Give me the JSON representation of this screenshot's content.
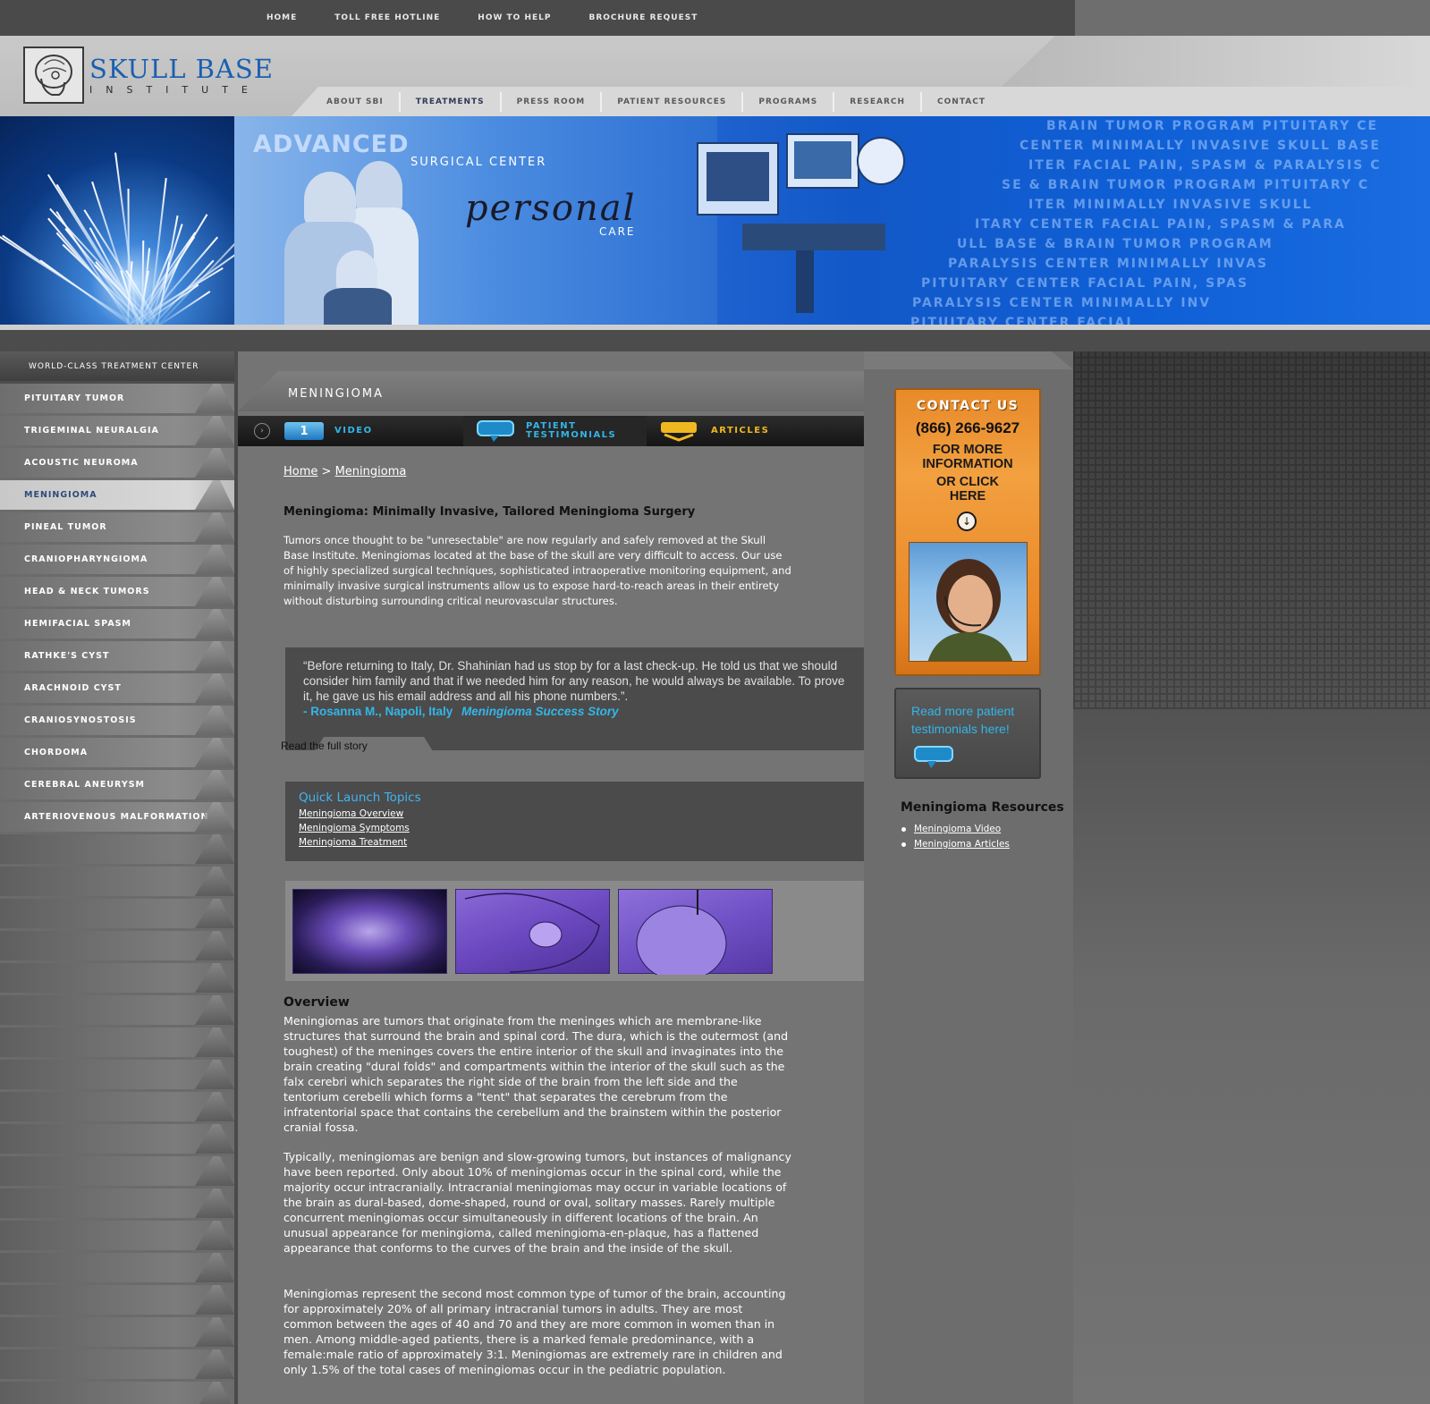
{
  "top_nav": [
    "HOME",
    "TOLL FREE HOTLINE",
    "HOW TO HELP",
    "BROCHURE REQUEST"
  ],
  "logo": {
    "title": "SKULL BASE",
    "subtitle": "INSTITUTE"
  },
  "main_nav": [
    {
      "label": "ABOUT SBI",
      "active": false
    },
    {
      "label": "TREATMENTS",
      "active": true
    },
    {
      "label": "PRESS ROOM",
      "active": false
    },
    {
      "label": "PATIENT RESOURCES",
      "active": false
    },
    {
      "label": "PROGRAMS",
      "active": false
    },
    {
      "label": "RESEARCH",
      "active": false
    },
    {
      "label": "CONTACT",
      "active": false
    }
  ],
  "banner": {
    "title": "ADVANCED",
    "subtitle": "SURGICAL CENTER",
    "script": "personal",
    "care": "CARE",
    "words": [
      "BRAIN TUMOR PROGRAM  PITUITARY CE",
      "CENTER  MINIMALLY INVASIVE SKULL BASE",
      "ITER  FACIAL PAIN, SPASM & PARALYSIS C",
      "SE & BRAIN TUMOR PROGRAM  PITUITARY C",
      "ITER  MINIMALLY INVASIVE SKULL",
      "ITARY CENTER  FACIAL PAIN, SPASM & PARA",
      "ULL BASE & BRAIN TUMOR PROGRAM",
      "PARALYSIS CENTER  MINIMALLY INVAS",
      "PITUITARY CENTER  FACIAL PAIN, SPAS",
      "PARALYSIS CENTER  MINIMALLY INV",
      "PITUITARY CENTER  FACIAL"
    ]
  },
  "sidebar": {
    "heading": "WORLD-CLASS TREATMENT CENTER",
    "items": [
      {
        "label": "PITUITARY TUMOR",
        "active": false
      },
      {
        "label": "TRIGEMINAL NEURALGIA",
        "active": false
      },
      {
        "label": "ACOUSTIC NEUROMA",
        "active": false
      },
      {
        "label": "MENINGIOMA",
        "active": true
      },
      {
        "label": "PINEAL TUMOR",
        "active": false
      },
      {
        "label": "CRANIOPHARYNGIOMA",
        "active": false
      },
      {
        "label": "HEAD & NECK TUMORS",
        "active": false
      },
      {
        "label": "HEMIFACIAL SPASM",
        "active": false
      },
      {
        "label": "RATHKE'S CYST",
        "active": false
      },
      {
        "label": "ARACHNOID CYST",
        "active": false
      },
      {
        "label": "CRANIOSYNOSTOSIS",
        "active": false
      },
      {
        "label": "CHORDOMA",
        "active": false
      },
      {
        "label": "CEREBRAL ANEURYSM",
        "active": false
      },
      {
        "label": "ARTERIOVENOUS MALFORMATION",
        "active": false
      }
    ]
  },
  "main": {
    "page_title": "MENINGIOMA",
    "media_tabs": {
      "video": "VIDEO",
      "testimonials_1": "PATIENT",
      "testimonials_2": "TESTIMONIALS",
      "articles": "ARTICLES"
    },
    "breadcrumb": {
      "home": "Home",
      "separator": ">",
      "current": "Meningioma"
    },
    "article_title": "Meningioma: Minimally Invasive, Tailored Meningioma Surgery",
    "intro": "Tumors once thought to be \"unresectable\" are now regularly and safely removed at the Skull Base Institute. Meningiomas located at the base of the skull are very difficult to access. Our use of highly specialized surgical techniques, sophisticated intraoperative monitoring equipment, and minimally invasive surgical instruments allow us to expose hard-to-reach areas in their entirety without disturbing surrounding critical neurovascular structures.",
    "quote": {
      "text": "“Before returning to Italy, Dr. Shahinian had us stop by for a last check-up. He told us that we should consider him family and that if we needed him for any reason, he would always be available. To prove it, he gave us his email address and all his phone numbers.”.",
      "author": "- Rosanna M., Napoli, Italy",
      "story_link": "Meningioma Success Story",
      "read_full": "Read the full story"
    },
    "quick_launch": {
      "title": "Quick Launch Topics",
      "links": [
        "Meningioma Overview",
        "Meningioma Symptoms",
        "Meningioma Treatment"
      ]
    },
    "overview_title": "Overview",
    "paragraphs": [
      "Meningiomas are tumors that originate from the meninges which are membrane-like structures that surround the brain and spinal cord. The dura, which is the outermost (and toughest) of the meninges covers the entire interior of the skull and invaginates into the brain creating \"dural folds\" and compartments within the interior of the skull such as the falx cerebri which separates the right side of the brain from the left side and the tentorium cerebelli which forms a \"tent\" that separates the cerebrum from the infratentorial space that contains the cerebellum and the brainstem within the posterior cranial fossa.",
      "Typically, meningiomas are benign and slow-growing tumors, but instances of malignancy have been reported. Only about 10% of meningiomas occur in the spinal cord, while the majority occur intracranially. Intracranial meningiomas may occur in variable locations of the brain as dural-based, dome-shaped, round or oval, solitary masses. Rarely multiple concurrent meningiomas occur simultaneously in different locations of the brain. An unusual appearance for meningioma, called meningioma-en-plaque, has a flattened appearance that conforms to the curves of the brain and the inside of the skull.",
      "Meningiomas represent the second most common type of tumor of the brain, accounting for approximately 20% of all primary intracranial tumors in adults. They are most common between the ages of 40 and 70 and they are more common in women than in men. Among middle-aged patients, there is a marked female predominance, with a female:male ratio of approximately 3:1. Meningiomas are extremely rare in children and only 1.5% of the total cases of meningiomas occur in the pediatric population."
    ]
  },
  "right": {
    "contact": {
      "title": "CONTACT US",
      "phone": "(866) 266-9627",
      "line1": "FOR MORE",
      "line2": "INFORMATION",
      "line3": "OR CLICK",
      "line4": "HERE"
    },
    "testimonials_cta": "Read more patient testimonials here!",
    "resources_title": "Meningioma Resources",
    "resources": [
      "Meningioma Video",
      "Meningioma Articles"
    ]
  },
  "colors": {
    "brand_blue": "#1b5fb0",
    "accent_cyan": "#33b6e8",
    "contact_orange": "#f2a040",
    "thumb_purple": "#7a5cc8"
  }
}
